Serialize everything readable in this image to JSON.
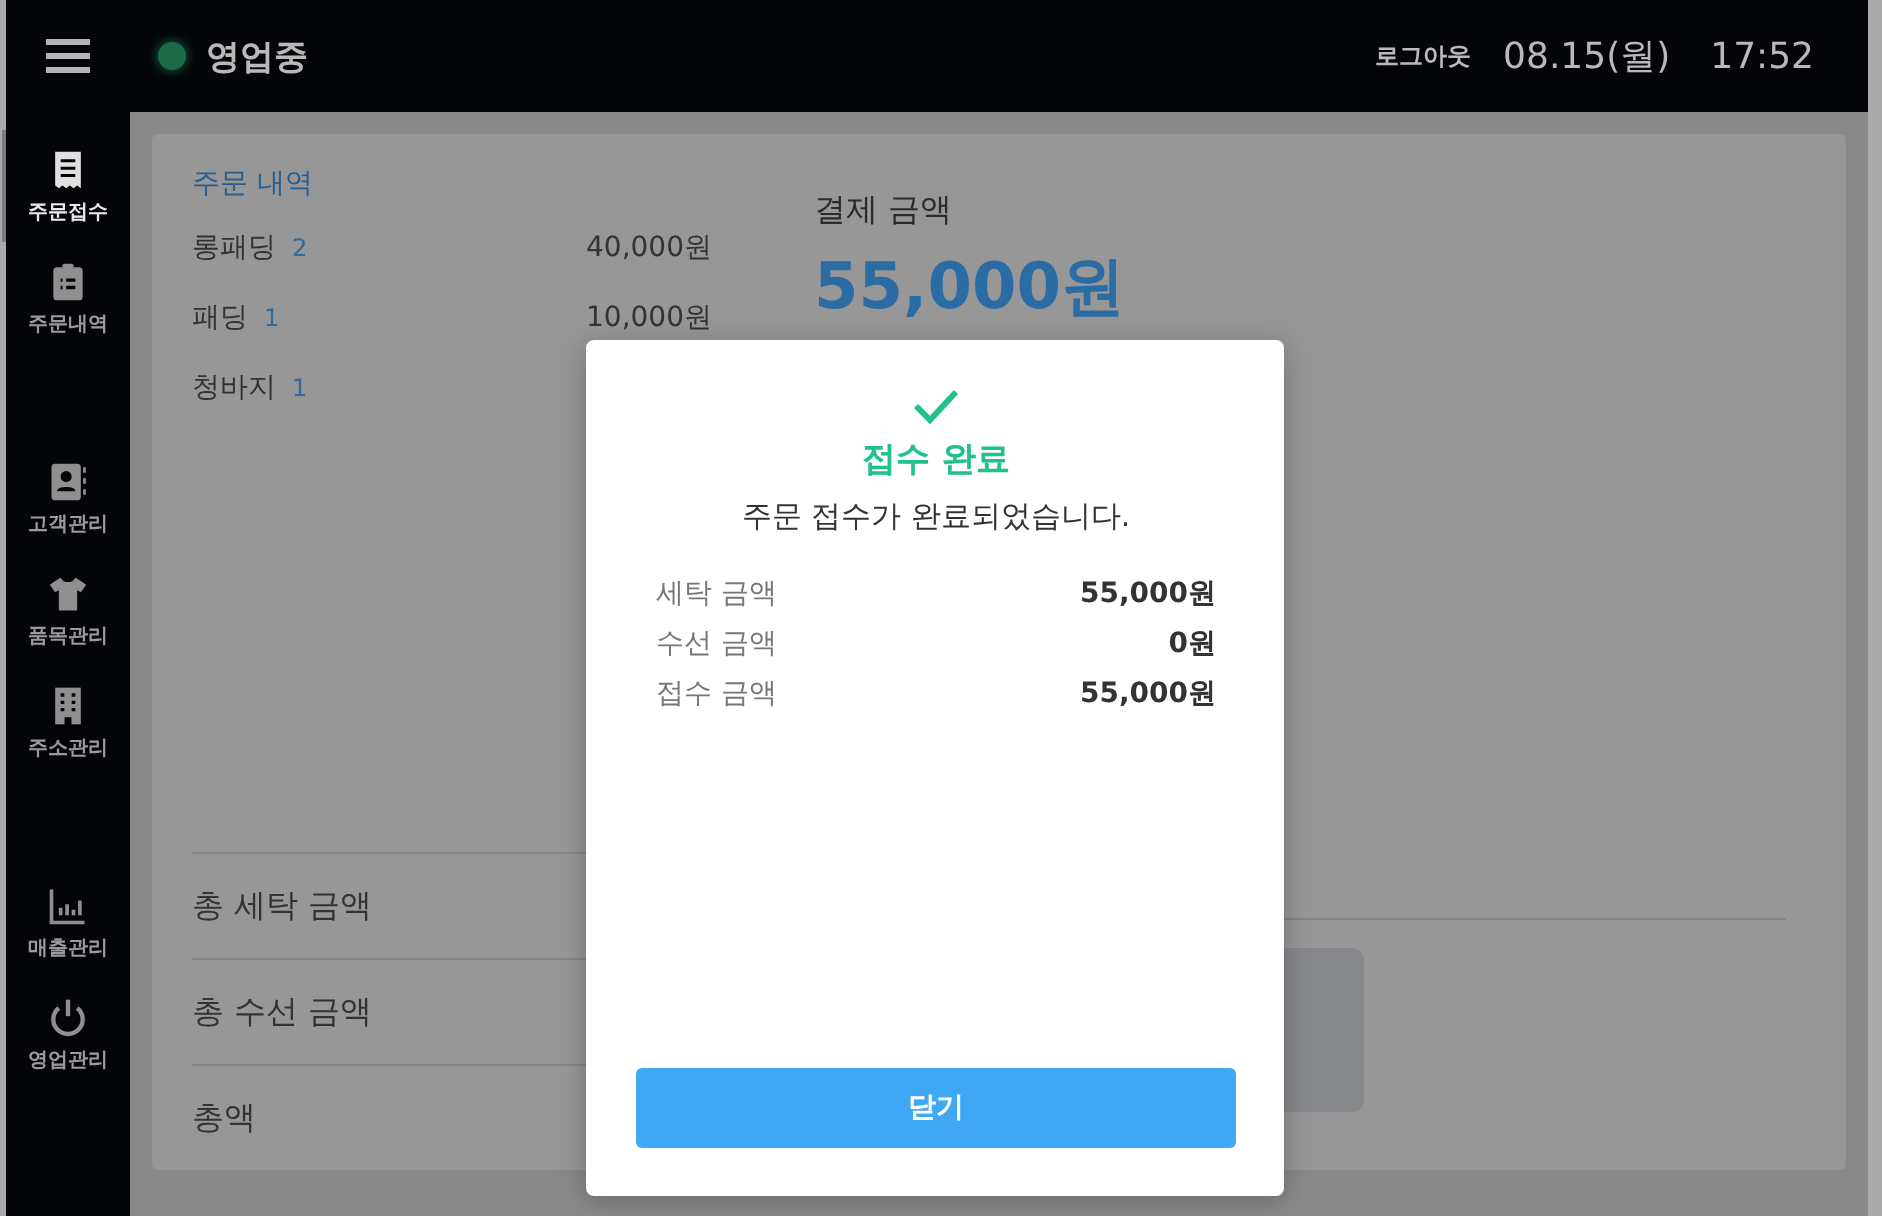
{
  "header": {
    "status": {
      "label": "영업중",
      "color": "#1b6b4a"
    },
    "logout": "로그아웃",
    "date": "08.15(월)",
    "time": "17:52"
  },
  "sidebar": {
    "groups": [
      {
        "items": [
          {
            "label": "주문접수",
            "selected": true
          },
          {
            "label": "주문내역",
            "selected": false
          }
        ]
      },
      {
        "items": [
          {
            "label": "고객관리",
            "selected": false
          },
          {
            "label": "품목관리",
            "selected": false
          },
          {
            "label": "주소관리",
            "selected": false
          }
        ]
      },
      {
        "items": [
          {
            "label": "매출관리",
            "selected": false
          },
          {
            "label": "영업관리",
            "selected": false
          }
        ]
      }
    ]
  },
  "order": {
    "title": "주문 내역",
    "items": [
      {
        "name": "롱패딩",
        "qty": "2",
        "price": "40,000원"
      },
      {
        "name": "패딩",
        "qty": "1",
        "price": "10,000원"
      },
      {
        "name": "청바지",
        "qty": "1"
      }
    ],
    "totals": [
      {
        "label": "총 세탁 금액"
      },
      {
        "label": "총 수선 금액"
      },
      {
        "label": "총액"
      }
    ]
  },
  "payment": {
    "label": "결제 금액",
    "amount": "55,000원"
  },
  "dialog": {
    "title": "접수 완료",
    "message": "주문 접수가 완료되었습니다.",
    "rows": [
      {
        "label": "세탁 금액",
        "value": "55,000원"
      },
      {
        "label": "수선 금액",
        "value": "0원"
      },
      {
        "label": "접수 금액",
        "value": "55,000원"
      }
    ],
    "button": "닫기"
  }
}
